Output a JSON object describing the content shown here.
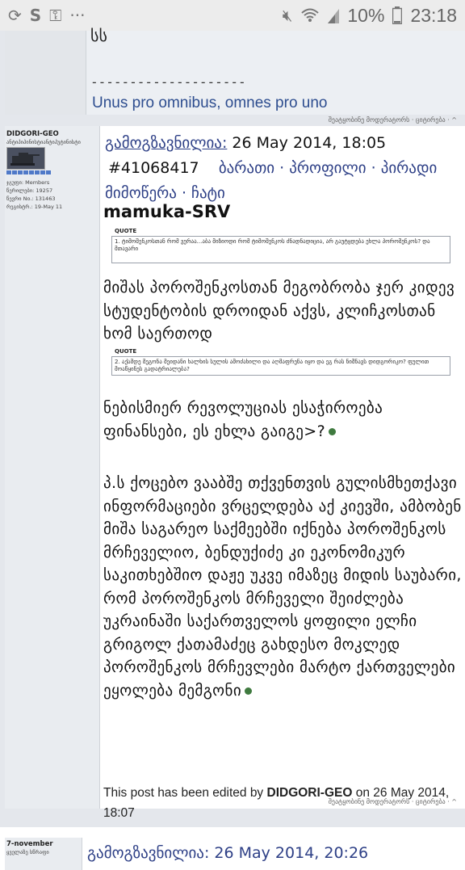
{
  "statusbar": {
    "battery": "10%",
    "time": "23:18",
    "icons": [
      "sync-icon",
      "skype-icon",
      "key-icon",
      "more-icon",
      "mute-icon",
      "wifi-icon",
      "signal-icon",
      "battery-icon"
    ]
  },
  "prev_post": {
    "fragment": "სს",
    "sig_line": "--------------------",
    "sig_text": "Unus pro omnibus, omnes pro uno",
    "actions": "შეატყობინე მოდერატორს · ციტირება · ^"
  },
  "post": {
    "author": "DIDGORI-GEO",
    "author_title": "ანტიპიპინისტიანტიპუტინისტი",
    "group": "ჯგუფი: Members",
    "posts": "წერილები: 19257",
    "member_no": "წევრი No.: 131463",
    "registered": "რეგისტრ.: 19-May 11",
    "sent_label": "გამოგზავნილია:",
    "date": "26 May 2014, 18:05",
    "post_id": "#41068417",
    "links": [
      "ბარათი",
      "პროფილი",
      "პირადი მიმოწერა",
      "ჩატი"
    ],
    "poster": "mamuka-SRV",
    "quote_label": "QUOTE",
    "quote1": "1. ტიმოშენკოსთან რომ ვერაა...აბა მიზიოდი რომ ტიმოშენკოს ძნადნადიცია, არ გაუტყდება ეხლა პოროშენკოს? და მთავარი",
    "text1": "მიშას პოროშენკოსთან მეგობრობა ჯერ კიდევ სტუდენტობის დროიდან აქვს, კლიჩკოსთან ხომ საერთოდ",
    "quote2": "2. აქამდე მეგონა მეიდანი ხალხის სულის ამოძახილი და აღმაფრენა იყო და ეგ რას ნიშნავს დიდგორიკო? ფულით მოაწყინეს გადატრიალება?",
    "text2": "ნებისმიერ რევოლუციას ესაჭიროება ფინანსები, ეს ეხლა გაიგე>?",
    "text3": "პ.ს ქოცებო ვააბშე თქვენთვის გულისმხეთქავი ინფორმაციები ვრცელდება აქ კიევში, ამბობენ მიშა საგარეო საქმეებში იქნება პოროშენკოს მრჩეველიო, ბენდუქიძე კი ეკონომიკურ საკითხებშიო დაჟე უკვე იმაზეც მიდის საუბარი, რომ პოროშენკოს მრჩეველი შეიძლება უკრაინაში საქართველოს ყოფილი ელჩი გრიგოლ ქათამაძეც გახდესო მოკლედ პოროშენკოს მრჩევლები მარტო ქართველები ეყოლება მემგონი",
    "edited_prefix": "This post has been edited by",
    "edited_by": "DIDGORI-GEO",
    "edited_on": "on 26 May 2014, 18:07",
    "actions": "შეატყობინე მოდერატორს · ციტირება · ^"
  },
  "next_post": {
    "author": "7-november",
    "author_title": "ყველაზე სწრაფი",
    "header": "გამოგზავნილია: 26 May 2014, 20:26"
  }
}
